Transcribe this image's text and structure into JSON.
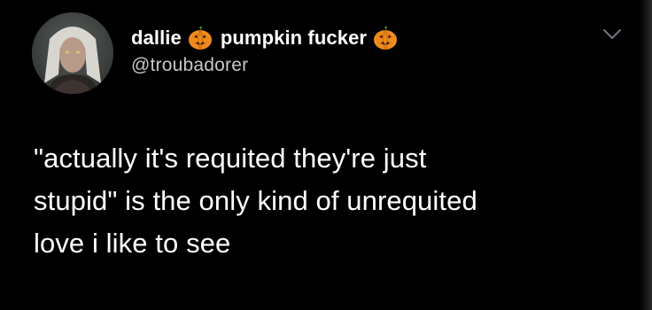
{
  "tweet": {
    "display_name_part1": "dallie",
    "display_name_part2": "pumpkin fucker",
    "emoji_icon": "jack-o-lantern-icon",
    "handle": "@troubadorer",
    "text_lines": [
      "\"actually it's requited they're just",
      "stupid\" is the only kind of unrequited",
      "love i like to see"
    ],
    "menu_icon": "chevron-down-icon"
  },
  "colors": {
    "background": "#000000",
    "text": "#ffffff",
    "handle_text": "#c8c8c8",
    "pumpkin": "#f08a1c",
    "chevron": "#6e767d"
  }
}
